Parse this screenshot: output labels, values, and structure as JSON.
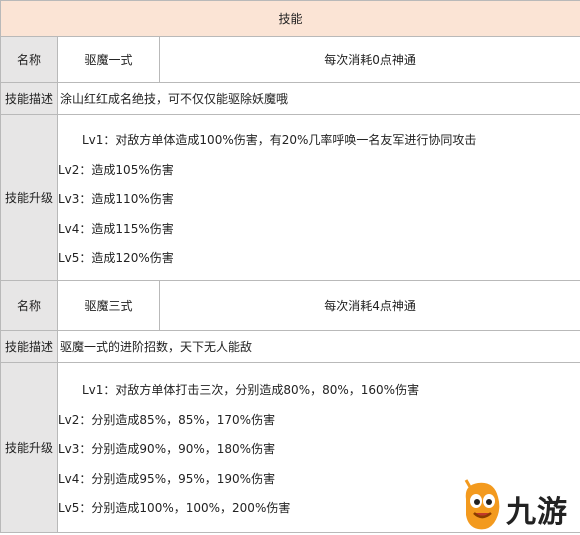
{
  "title": "技能",
  "skills": [
    {
      "name_label": "名称",
      "name": "驱魔一式",
      "cost": "每次消耗0点神通",
      "desc_label": "技能描述",
      "desc": "涂山红红成名绝技，可不仅仅能驱除妖魔哦",
      "upgrade_label": "技能升级",
      "levels": [
        "Lv1：对敌方单体造成100%伤害，有20%几率呼唤一名友军进行协同攻击",
        "Lv2：造成105%伤害",
        "Lv3：造成110%伤害",
        "Lv4：造成115%伤害",
        "Lv5：造成120%伤害"
      ]
    },
    {
      "name_label": "名称",
      "name": "驱魔三式",
      "cost": "每次消耗4点神通",
      "desc_label": "技能描述",
      "desc": "驱魔一式的进阶招数，天下无人能敌",
      "upgrade_label": "技能升级",
      "levels": [
        "Lv1：对敌方单体打击三次，分别造成80%，80%，160%伤害",
        "Lv2：分别造成85%，85%，170%伤害",
        "Lv3：分别造成90%，90%，180%伤害",
        "Lv4：分别造成95%，95%，190%伤害",
        "Lv5：分别造成100%，100%，200%伤害"
      ]
    }
  ],
  "watermark": "九游",
  "colors": {
    "header_bg": "#fbe4d5",
    "label_bg": "#e7e6e6",
    "logo_orange": "#f39a1e"
  }
}
